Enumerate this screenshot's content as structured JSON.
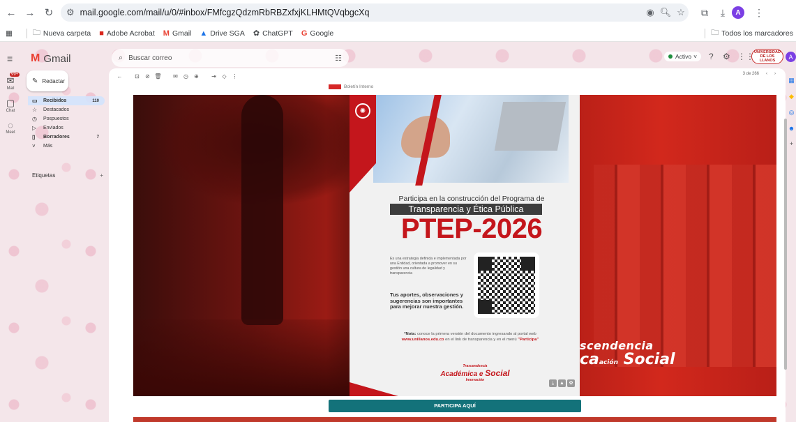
{
  "browser": {
    "url": "mail.google.com/mail/u/0/#inbox/FMfcgzQdzmRbRBZxfxjKLHMtQVqbgcXq",
    "profile_initial": "A"
  },
  "bookmarks": {
    "items": [
      "Nueva carpeta",
      "Adobe Acrobat",
      "Gmail",
      "Drive SGA",
      "ChatGPT",
      "Google"
    ],
    "all_label": "Todos los marcadores"
  },
  "rail": {
    "mail_label": "Mail",
    "mail_badge": "99+",
    "chat_label": "Chat",
    "meet_label": "Meet"
  },
  "gmail": {
    "app_name": "Gmail",
    "search_placeholder": "Buscar correo",
    "status": "Activo",
    "account_initial": "A",
    "org_logo_text": "UNIVERSIDAD DE LOS LLANOS"
  },
  "compose": {
    "label": "Redactar"
  },
  "nav": {
    "items": [
      {
        "label": "Recibidos",
        "count": "110",
        "icon": "inbox-icon"
      },
      {
        "label": "Destacados",
        "count": "",
        "icon": "star-icon"
      },
      {
        "label": "Pospuestos",
        "count": "",
        "icon": "clock-icon"
      },
      {
        "label": "Enviados",
        "count": "",
        "icon": "send-icon"
      },
      {
        "label": "Borradores",
        "count": "7",
        "icon": "draft-icon"
      },
      {
        "label": "Más",
        "count": "",
        "icon": "chevron-down-icon"
      }
    ],
    "labels_heading": "Etiquetas"
  },
  "message": {
    "pager": "3 de 266",
    "header_snippet": "Boletín Interno"
  },
  "poster": {
    "participa": "Participa en la construcción del Programa de",
    "transparencia": "Transparencia y Ética Pública",
    "title": "PTEP-2026",
    "description": "Es una estrategia definida e implementada por una Entidad, orientada a promover en su gestión una cultura de legalidad y transparencia",
    "aportes": "Tus aportes, observaciones y sugerencias son importantes para mejorar nuestra gestión.",
    "nota_label": "*Nota:",
    "nota_text": "conoce la primera versión del documento ingresando al portal web",
    "nota_url": "www.unillanos.edu.co",
    "nota_text2": "en el link de transparencia y en el menú",
    "nota_menu": "\"Participa\"",
    "brand_top": "Trascendencia",
    "brand_main": "Académica e",
    "brand_social": "Social",
    "brand_sub": "Innovación"
  },
  "hero_slogan": {
    "line1": "scendencia",
    "line2a": "ca",
    "line2b": "ación",
    "line2c": "Social"
  },
  "cta": {
    "label": "PARTICIPA AQUÍ"
  },
  "colors": {
    "brand_red": "#c4161c",
    "cta_teal": "#13727a"
  }
}
